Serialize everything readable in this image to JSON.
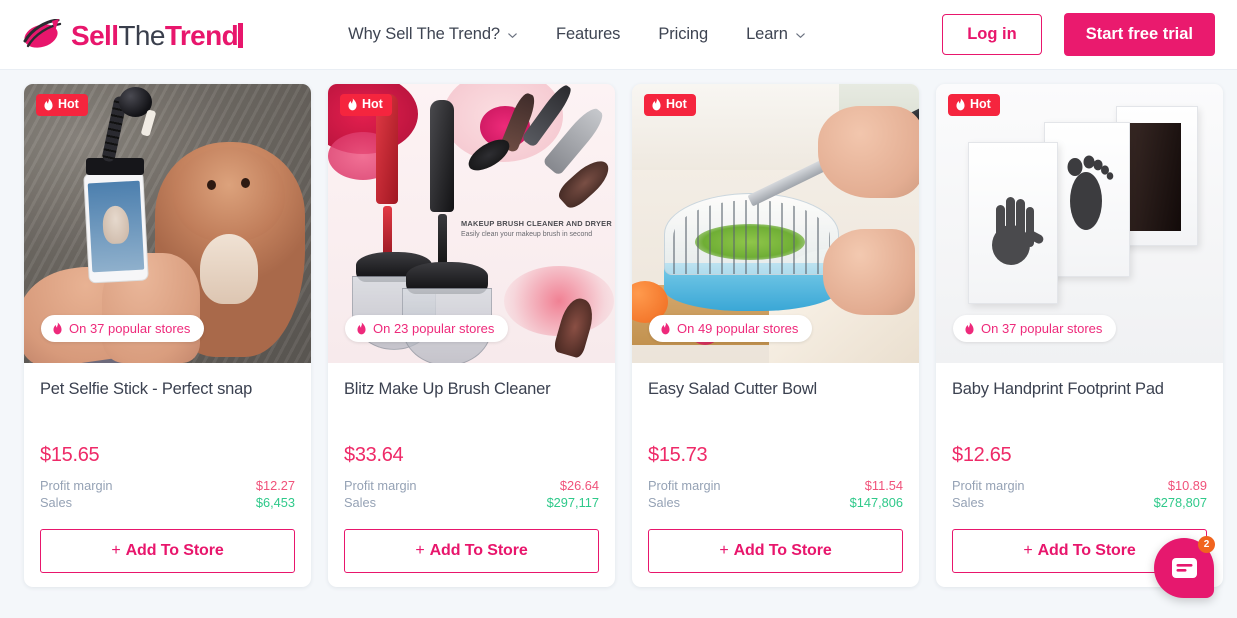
{
  "brand": {
    "logo_icon": "swoosh-logo-icon",
    "word1": "Sell",
    "word2": "The",
    "word3": "Trend",
    "accent_color": "#e8166c",
    "dark_color": "#3a3f4c"
  },
  "nav": {
    "items": [
      {
        "label": "Why Sell The Trend?",
        "has_dropdown": true,
        "icon": "chevron-down-icon"
      },
      {
        "label": "Features",
        "has_dropdown": false,
        "icon": ""
      },
      {
        "label": "Pricing",
        "has_dropdown": false,
        "icon": ""
      },
      {
        "label": "Learn",
        "has_dropdown": true,
        "icon": "chevron-down-icon"
      }
    ],
    "login_label": "Log in",
    "trial_label": "Start free trial"
  },
  "labels": {
    "hot": "Hot",
    "hot_icon": "flame-icon",
    "stores_icon": "flame-icon",
    "profit_margin": "Profit margin",
    "sales": "Sales",
    "add_to_store": "Add To Store",
    "plus": "+"
  },
  "colors": {
    "page_bg": "#f4f7fa",
    "hot_badge": "#f5253e",
    "price": "#ee2a68",
    "margin": "#f0527a",
    "sales": "#2fc98a",
    "chat": "#e6186e",
    "chat_badge": "#f1641e"
  },
  "products": [
    {
      "title": "Pet Selfie Stick - Perfect snap",
      "price": "$15.65",
      "profit_margin": "$12.27",
      "sales": "$6,453",
      "stores_text": "On 37 popular stores",
      "hot": "Hot",
      "image_alt": "pet-selfie-stick-photo"
    },
    {
      "title": "Blitz Make Up Brush Cleaner",
      "price": "$33.64",
      "profit_margin": "$26.64",
      "sales": "$297,117",
      "stores_text": "On 23 popular stores",
      "hot": "Hot",
      "image_alt": "makeup-brush-cleaner-photo",
      "image_overlay_title": "MAKEUP BRUSH CLEANER AND DRYER",
      "image_overlay_sub": "Easily clean your makeup brush in second"
    },
    {
      "title": "Easy Salad Cutter Bowl",
      "price": "$15.73",
      "profit_margin": "$11.54",
      "sales": "$147,806",
      "stores_text": "On 49 popular stores",
      "hot": "Hot",
      "image_alt": "salad-cutter-bowl-photo"
    },
    {
      "title": "Baby Handprint Footprint Pad",
      "price": "$12.65",
      "profit_margin": "$10.89",
      "sales": "$278,807",
      "stores_text": "On 37 popular stores",
      "hot": "Hot",
      "image_alt": "baby-handprint-footprint-pad-photo"
    }
  ],
  "chat": {
    "icon": "chat-message-icon",
    "unread_count": "2"
  }
}
